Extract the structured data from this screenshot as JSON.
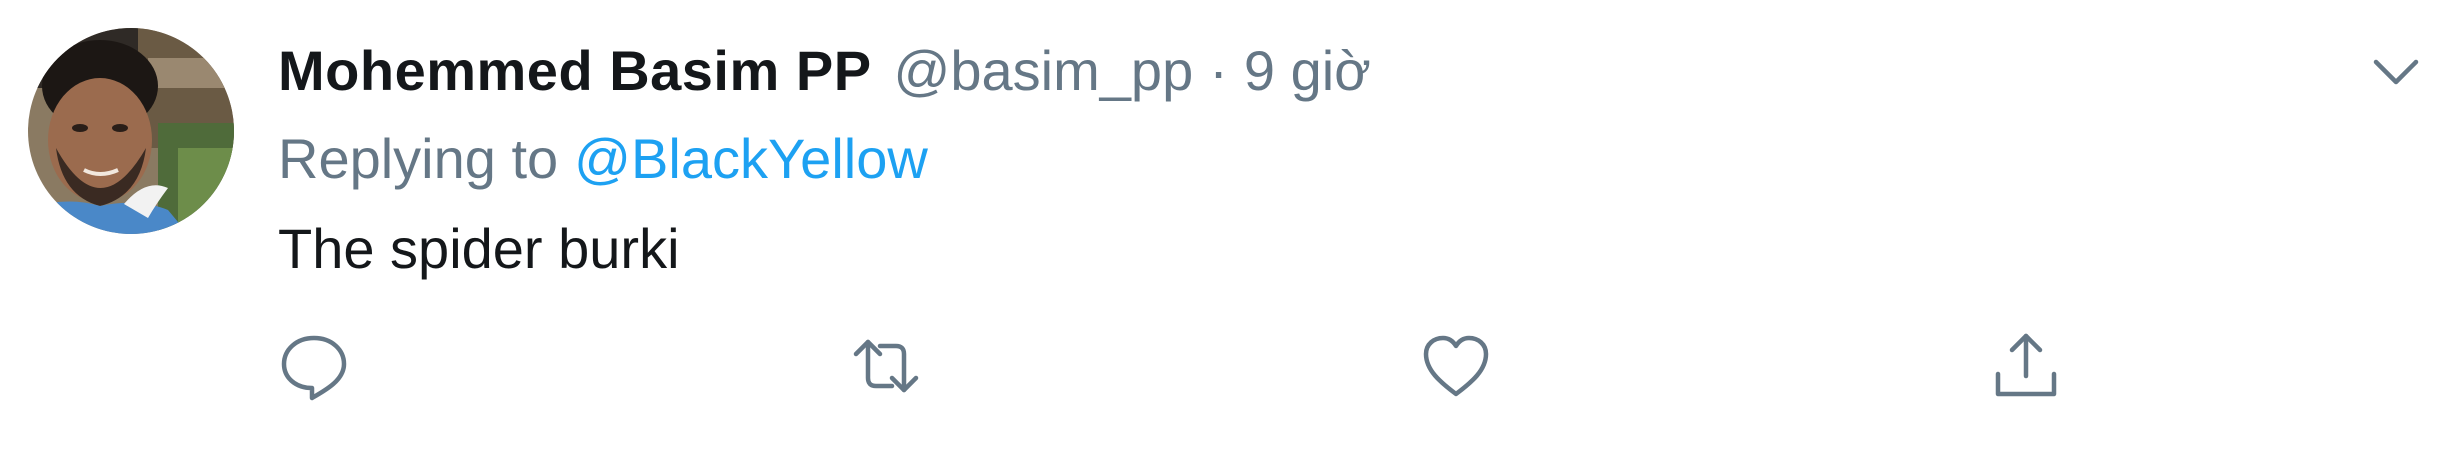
{
  "tweet": {
    "author": {
      "display_name": "Mohemmed Basim PP",
      "handle": "@basim_pp",
      "avatar_icon": "user-avatar-photo"
    },
    "separator": "·",
    "time": "9 giờ",
    "reply_prefix": "Replying to",
    "reply_to": "@BlackYellow",
    "text": "The spider burki"
  },
  "actions": [
    {
      "name": "reply",
      "icon": "speech-bubble-icon"
    },
    {
      "name": "retweet",
      "icon": "retweet-arrows-icon"
    },
    {
      "name": "like",
      "icon": "heart-icon"
    },
    {
      "name": "share",
      "icon": "share-upload-icon"
    }
  ],
  "colors": {
    "primary_text": "#14171a",
    "secondary_text": "#657786",
    "link": "#1da1f2",
    "icon": "#657786"
  }
}
